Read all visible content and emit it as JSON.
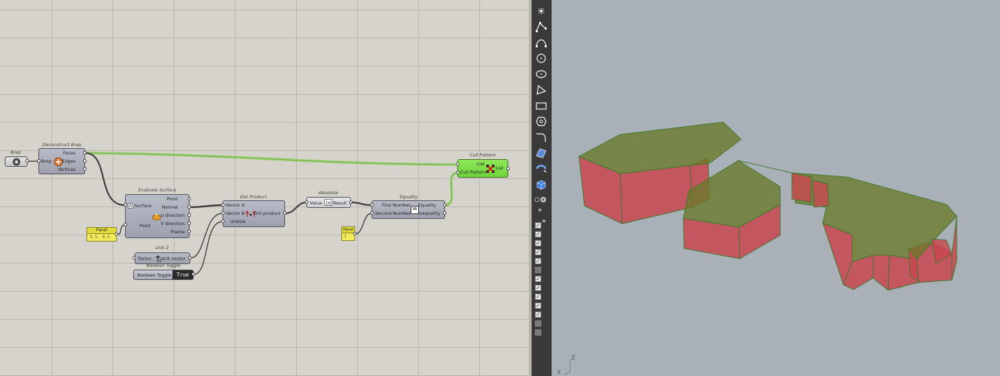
{
  "canvas": {
    "brep_param": {
      "title": "Brep"
    },
    "deconstruct_brep": {
      "title": "Deconstruct Brep",
      "input": "Brep",
      "outputs": [
        "Faces",
        "Edges",
        "Vertices"
      ]
    },
    "evaluate_surface": {
      "title": "Evaluate Surface",
      "inputs": [
        "Surface",
        "Point"
      ],
      "outputs": [
        "Point",
        "Normal",
        "U direction",
        "V direction",
        "Frame"
      ]
    },
    "panel_uv": {
      "title": "Panel",
      "value": "0.5, 0.5"
    },
    "unit_z": {
      "title": "Unit Z",
      "input": "Factor",
      "output": "Unit vector"
    },
    "boolean_toggle": {
      "title": "Boolean Toggle",
      "label": "Boolean Toggle",
      "value": "True"
    },
    "dot_product": {
      "title": "Dot Product",
      "inputs": [
        "Vector A",
        "Vector B",
        "Unitize"
      ],
      "output": "Dot product"
    },
    "absolute": {
      "title": "Absolute",
      "input": "Value",
      "output": "Result"
    },
    "panel_one": {
      "title": "Panel",
      "value": "1"
    },
    "equality": {
      "title": "Equality",
      "inputs": [
        "First Number",
        "Second Number"
      ],
      "outputs": [
        "Equality",
        "Inequality"
      ],
      "symbol": "="
    },
    "cull_pattern": {
      "title": "Cull Pattern",
      "inputs": [
        "List",
        "Cull Pattern"
      ],
      "output": "List"
    }
  },
  "viewport": {
    "axis_z": "Z",
    "axis_x": "X"
  },
  "toolbar": {
    "expand_top": "»",
    "expand_mid": "»",
    "tools": [
      "point-icon",
      "polyline-icon",
      "curve-icon",
      "circle-icon",
      "ellipse-icon",
      "polygon-icon",
      "rectangle-icon",
      "cylinder-icon",
      "fillet-icon",
      "surface-icon",
      "revolve-icon",
      "solid-box-icon"
    ],
    "checkboxes": [
      true,
      true,
      true,
      true,
      true,
      false,
      true,
      true,
      true,
      true,
      true,
      false,
      false
    ]
  },
  "colors": {
    "canvas_bg": "#d6d3cc",
    "selected_node": "#7de04a",
    "wire_selected": "#9bd36d",
    "panel_yellow": "#f2ec5a",
    "face_red": "#c8464f",
    "face_green": "#6b7a2c",
    "viewport_bg": "#a9b0b8"
  }
}
